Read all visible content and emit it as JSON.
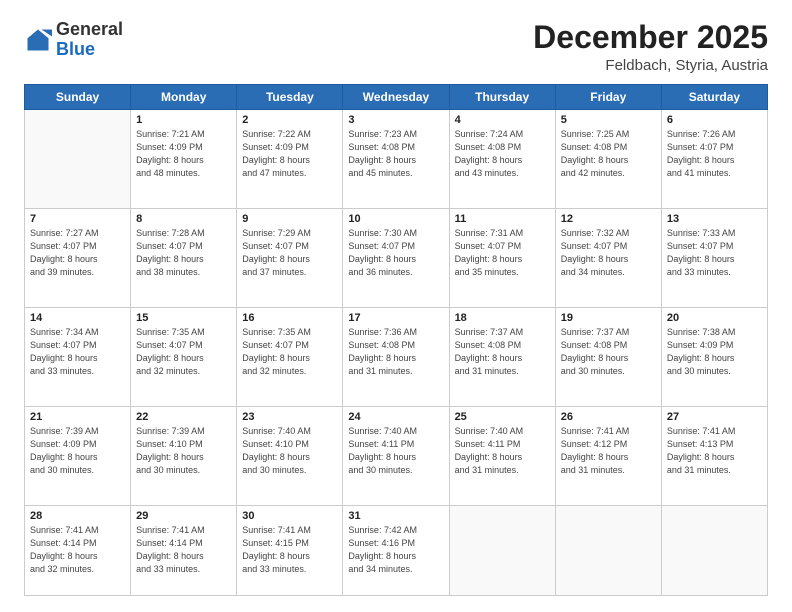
{
  "header": {
    "logo": {
      "general": "General",
      "blue": "Blue"
    },
    "title": "December 2025",
    "location": "Feldbach, Styria, Austria"
  },
  "weekdays": [
    "Sunday",
    "Monday",
    "Tuesday",
    "Wednesday",
    "Thursday",
    "Friday",
    "Saturday"
  ],
  "weeks": [
    [
      {
        "day": "",
        "info": ""
      },
      {
        "day": "1",
        "info": "Sunrise: 7:21 AM\nSunset: 4:09 PM\nDaylight: 8 hours\nand 48 minutes."
      },
      {
        "day": "2",
        "info": "Sunrise: 7:22 AM\nSunset: 4:09 PM\nDaylight: 8 hours\nand 47 minutes."
      },
      {
        "day": "3",
        "info": "Sunrise: 7:23 AM\nSunset: 4:08 PM\nDaylight: 8 hours\nand 45 minutes."
      },
      {
        "day": "4",
        "info": "Sunrise: 7:24 AM\nSunset: 4:08 PM\nDaylight: 8 hours\nand 43 minutes."
      },
      {
        "day": "5",
        "info": "Sunrise: 7:25 AM\nSunset: 4:08 PM\nDaylight: 8 hours\nand 42 minutes."
      },
      {
        "day": "6",
        "info": "Sunrise: 7:26 AM\nSunset: 4:07 PM\nDaylight: 8 hours\nand 41 minutes."
      }
    ],
    [
      {
        "day": "7",
        "info": "Sunrise: 7:27 AM\nSunset: 4:07 PM\nDaylight: 8 hours\nand 39 minutes."
      },
      {
        "day": "8",
        "info": "Sunrise: 7:28 AM\nSunset: 4:07 PM\nDaylight: 8 hours\nand 38 minutes."
      },
      {
        "day": "9",
        "info": "Sunrise: 7:29 AM\nSunset: 4:07 PM\nDaylight: 8 hours\nand 37 minutes."
      },
      {
        "day": "10",
        "info": "Sunrise: 7:30 AM\nSunset: 4:07 PM\nDaylight: 8 hours\nand 36 minutes."
      },
      {
        "day": "11",
        "info": "Sunrise: 7:31 AM\nSunset: 4:07 PM\nDaylight: 8 hours\nand 35 minutes."
      },
      {
        "day": "12",
        "info": "Sunrise: 7:32 AM\nSunset: 4:07 PM\nDaylight: 8 hours\nand 34 minutes."
      },
      {
        "day": "13",
        "info": "Sunrise: 7:33 AM\nSunset: 4:07 PM\nDaylight: 8 hours\nand 33 minutes."
      }
    ],
    [
      {
        "day": "14",
        "info": "Sunrise: 7:34 AM\nSunset: 4:07 PM\nDaylight: 8 hours\nand 33 minutes."
      },
      {
        "day": "15",
        "info": "Sunrise: 7:35 AM\nSunset: 4:07 PM\nDaylight: 8 hours\nand 32 minutes."
      },
      {
        "day": "16",
        "info": "Sunrise: 7:35 AM\nSunset: 4:07 PM\nDaylight: 8 hours\nand 32 minutes."
      },
      {
        "day": "17",
        "info": "Sunrise: 7:36 AM\nSunset: 4:08 PM\nDaylight: 8 hours\nand 31 minutes."
      },
      {
        "day": "18",
        "info": "Sunrise: 7:37 AM\nSunset: 4:08 PM\nDaylight: 8 hours\nand 31 minutes."
      },
      {
        "day": "19",
        "info": "Sunrise: 7:37 AM\nSunset: 4:08 PM\nDaylight: 8 hours\nand 30 minutes."
      },
      {
        "day": "20",
        "info": "Sunrise: 7:38 AM\nSunset: 4:09 PM\nDaylight: 8 hours\nand 30 minutes."
      }
    ],
    [
      {
        "day": "21",
        "info": "Sunrise: 7:39 AM\nSunset: 4:09 PM\nDaylight: 8 hours\nand 30 minutes."
      },
      {
        "day": "22",
        "info": "Sunrise: 7:39 AM\nSunset: 4:10 PM\nDaylight: 8 hours\nand 30 minutes."
      },
      {
        "day": "23",
        "info": "Sunrise: 7:40 AM\nSunset: 4:10 PM\nDaylight: 8 hours\nand 30 minutes."
      },
      {
        "day": "24",
        "info": "Sunrise: 7:40 AM\nSunset: 4:11 PM\nDaylight: 8 hours\nand 30 minutes."
      },
      {
        "day": "25",
        "info": "Sunrise: 7:40 AM\nSunset: 4:11 PM\nDaylight: 8 hours\nand 31 minutes."
      },
      {
        "day": "26",
        "info": "Sunrise: 7:41 AM\nSunset: 4:12 PM\nDaylight: 8 hours\nand 31 minutes."
      },
      {
        "day": "27",
        "info": "Sunrise: 7:41 AM\nSunset: 4:13 PM\nDaylight: 8 hours\nand 31 minutes."
      }
    ],
    [
      {
        "day": "28",
        "info": "Sunrise: 7:41 AM\nSunset: 4:14 PM\nDaylight: 8 hours\nand 32 minutes."
      },
      {
        "day": "29",
        "info": "Sunrise: 7:41 AM\nSunset: 4:14 PM\nDaylight: 8 hours\nand 33 minutes."
      },
      {
        "day": "30",
        "info": "Sunrise: 7:41 AM\nSunset: 4:15 PM\nDaylight: 8 hours\nand 33 minutes."
      },
      {
        "day": "31",
        "info": "Sunrise: 7:42 AM\nSunset: 4:16 PM\nDaylight: 8 hours\nand 34 minutes."
      },
      {
        "day": "",
        "info": ""
      },
      {
        "day": "",
        "info": ""
      },
      {
        "day": "",
        "info": ""
      }
    ]
  ]
}
